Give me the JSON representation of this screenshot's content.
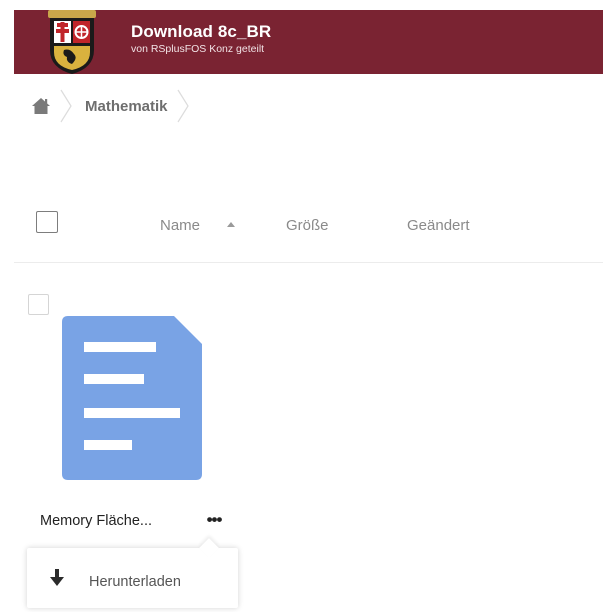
{
  "header": {
    "title": "Download 8c_BR",
    "subtitle": "von RSplusFOS Konz geteilt",
    "logo_icon": "coat-of-arms-icon",
    "bg_color": "#7a2332"
  },
  "breadcrumb": {
    "home_icon": "home-icon",
    "items": [
      {
        "label": "Mathematik"
      }
    ]
  },
  "list_header": {
    "columns": {
      "name": "Name",
      "size": "Größe",
      "modified": "Geändert"
    },
    "sort_icon": "sort-ascending-icon"
  },
  "files": [
    {
      "name": "Memory Fläche...",
      "icon": "document-icon",
      "icon_color": "#79a3e5"
    }
  ],
  "context_menu": {
    "items": [
      {
        "label": "Herunterladen",
        "icon": "download-icon"
      }
    ]
  }
}
